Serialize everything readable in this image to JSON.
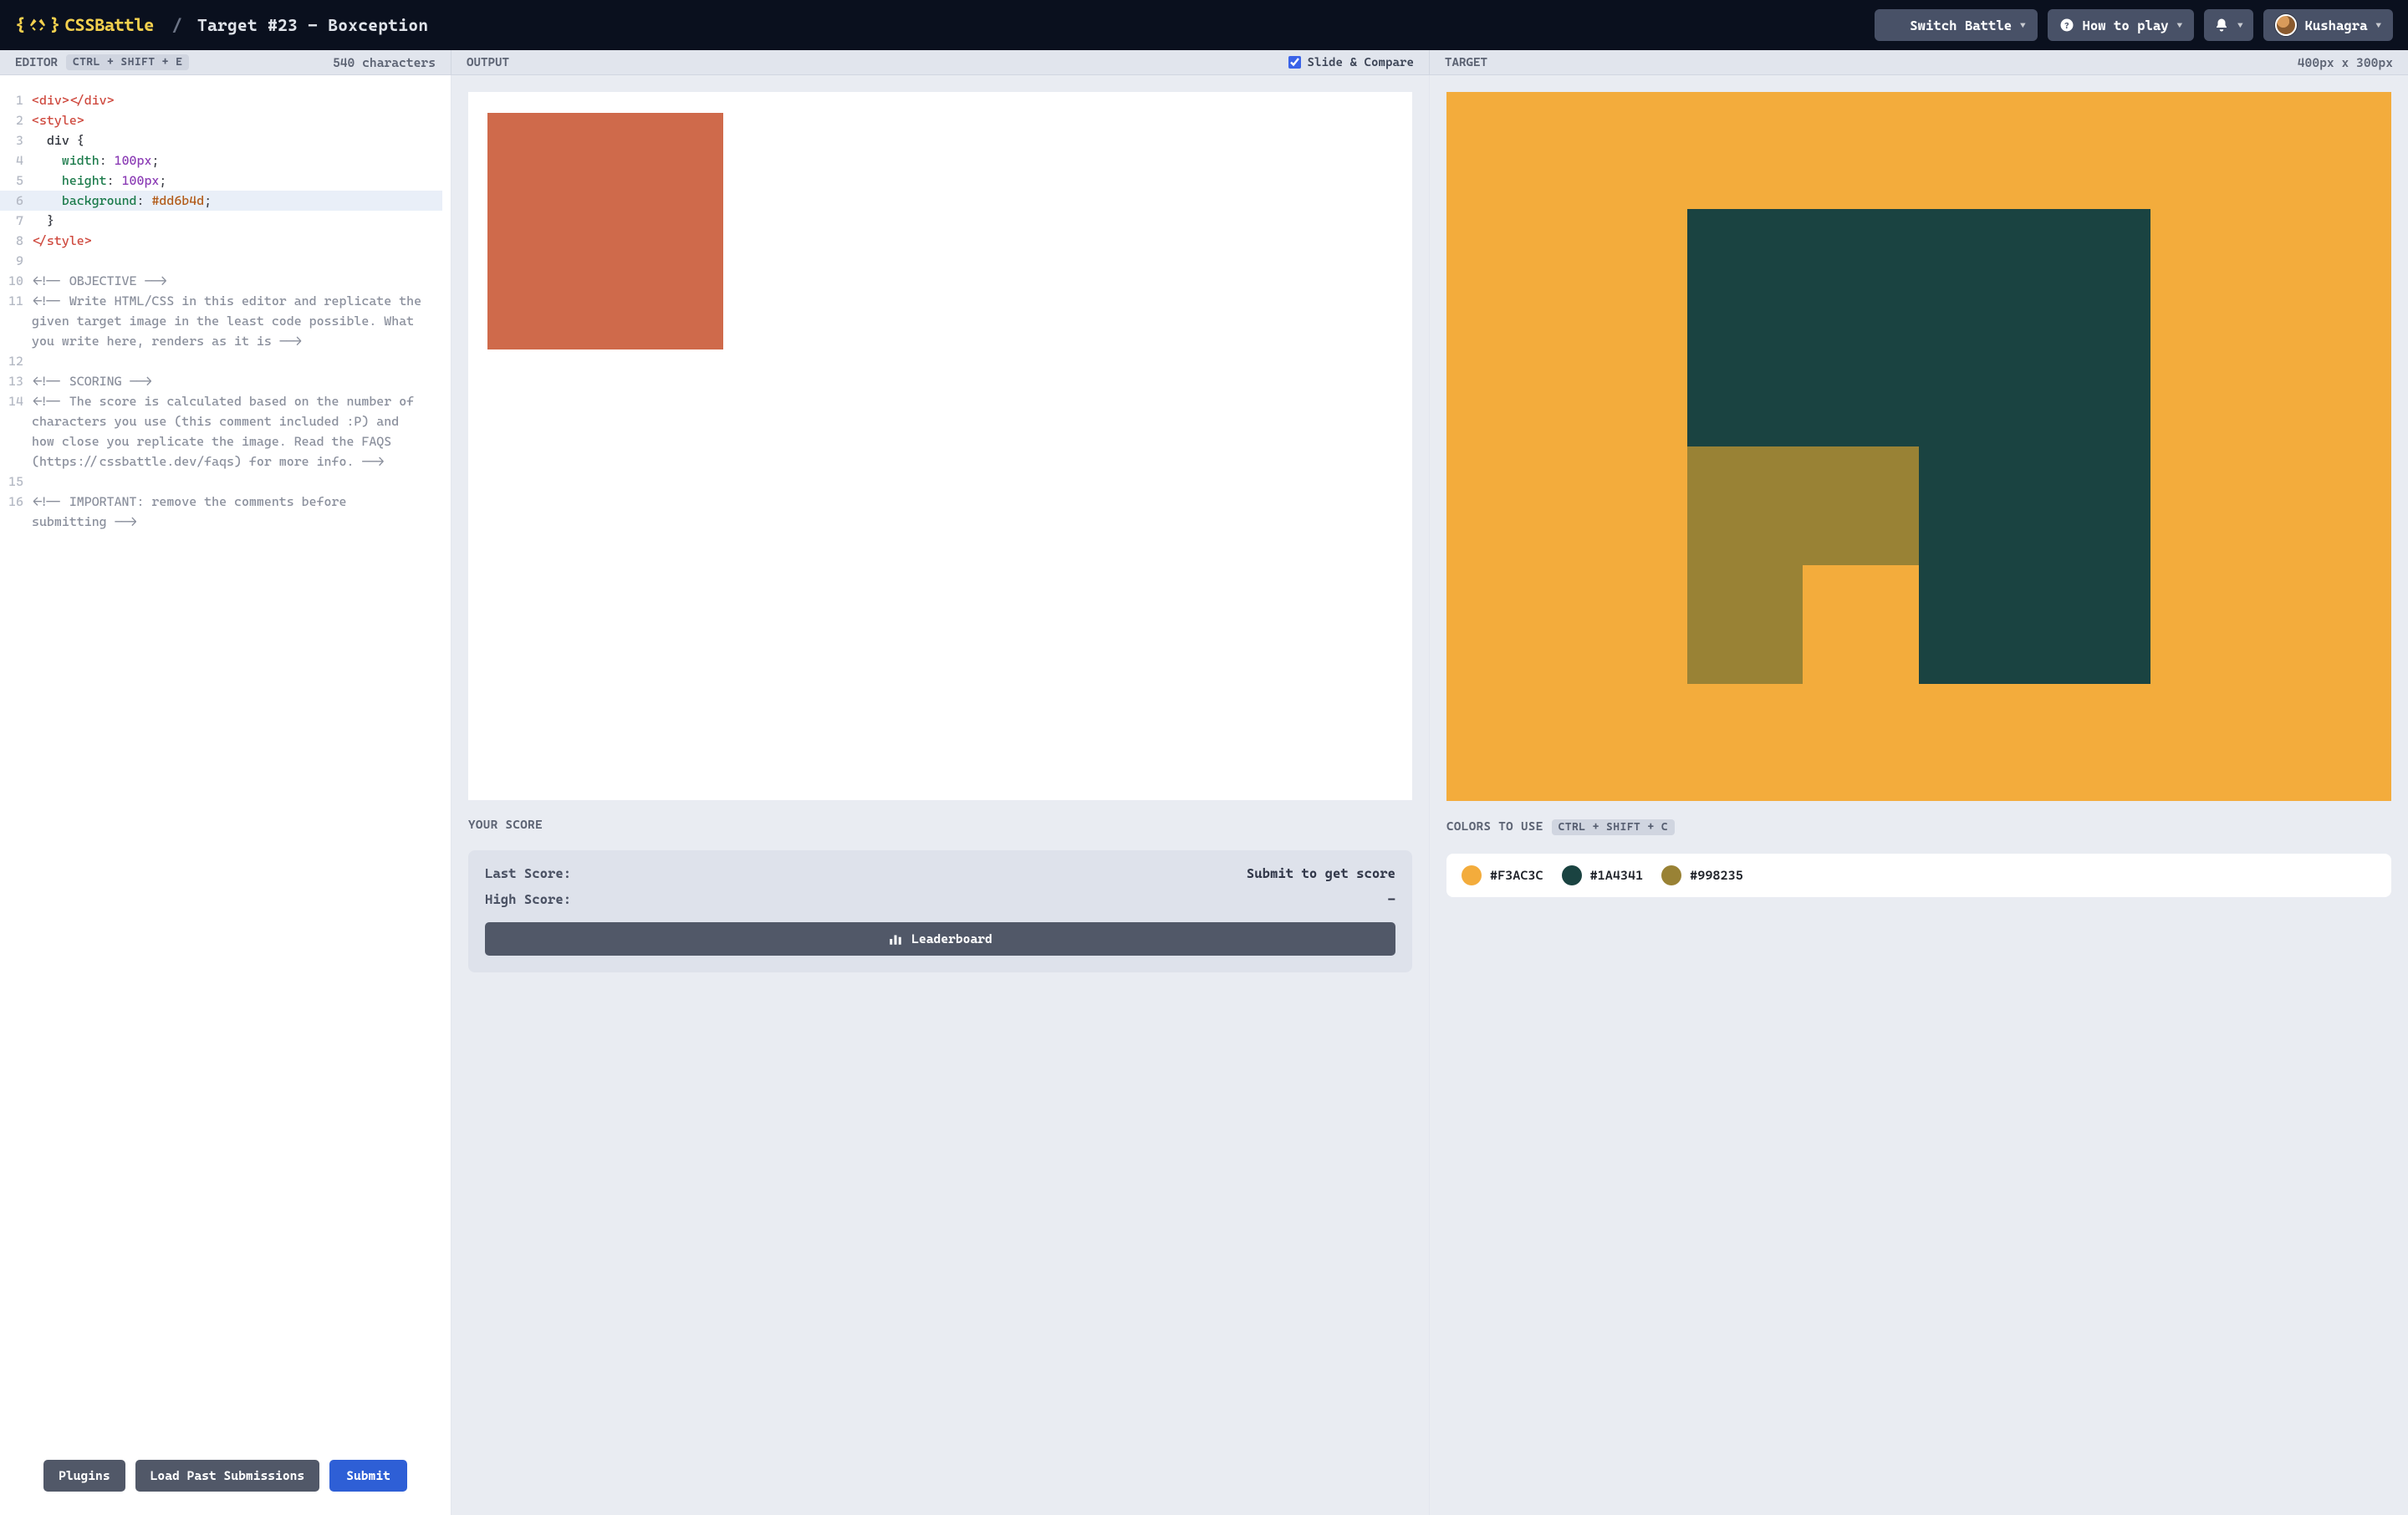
{
  "header": {
    "brand": "CSSBattle",
    "breadcrumb_slash": "/",
    "breadcrumb": "Target #23 - Boxception",
    "switch_battle": "Switch Battle",
    "how_to_play": "How to play",
    "username": "Kushagra"
  },
  "panels": {
    "editor": {
      "title": "EDITOR",
      "shortcut": "CTRL + SHIFT + E",
      "char_count": "540 characters"
    },
    "output": {
      "title": "OUTPUT",
      "slide_compare": "Slide & Compare",
      "slide_compare_checked": true
    },
    "target": {
      "title": "TARGET",
      "dimensions": "400px x 300px"
    }
  },
  "code_lines": [
    {
      "n": 1,
      "parts": [
        {
          "c": "tok-tag",
          "t": "<div></div>"
        }
      ]
    },
    {
      "n": 2,
      "parts": [
        {
          "c": "tok-tag",
          "t": "<style>"
        }
      ]
    },
    {
      "n": 3,
      "parts": [
        {
          "c": "tok-sel",
          "t": "  div "
        },
        {
          "c": "tok-punc",
          "t": "{"
        }
      ]
    },
    {
      "n": 4,
      "parts": [
        {
          "c": "",
          "t": "    "
        },
        {
          "c": "tok-prop",
          "t": "width"
        },
        {
          "c": "tok-punc",
          "t": ": "
        },
        {
          "c": "tok-num",
          "t": "100px"
        },
        {
          "c": "tok-punc",
          "t": ";"
        }
      ]
    },
    {
      "n": 5,
      "parts": [
        {
          "c": "",
          "t": "    "
        },
        {
          "c": "tok-prop",
          "t": "height"
        },
        {
          "c": "tok-punc",
          "t": ": "
        },
        {
          "c": "tok-num",
          "t": "100px"
        },
        {
          "c": "tok-punc",
          "t": ";"
        }
      ]
    },
    {
      "n": 6,
      "hl": true,
      "parts": [
        {
          "c": "",
          "t": "    "
        },
        {
          "c": "tok-prop",
          "t": "background"
        },
        {
          "c": "tok-punc",
          "t": ": "
        },
        {
          "c": "tok-hex",
          "t": "#dd6b4d"
        },
        {
          "c": "tok-punc",
          "t": ";"
        }
      ]
    },
    {
      "n": 7,
      "parts": [
        {
          "c": "tok-punc",
          "t": "  }"
        }
      ]
    },
    {
      "n": 8,
      "parts": [
        {
          "c": "tok-tag",
          "t": "</style>"
        }
      ]
    },
    {
      "n": 9,
      "parts": [
        {
          "c": "",
          "t": ""
        }
      ]
    },
    {
      "n": 10,
      "parts": [
        {
          "c": "",
          "t": "<!-- OBJECTIVE -->"
        }
      ]
    },
    {
      "n": 11,
      "parts": [
        {
          "c": "",
          "t": "<!-- Write HTML/CSS in this editor and replicate the given target image in the least code possible. What you write here, renders as it is -->"
        }
      ]
    },
    {
      "n": 12,
      "parts": [
        {
          "c": "",
          "t": ""
        }
      ]
    },
    {
      "n": 13,
      "parts": [
        {
          "c": "",
          "t": "<!-- SCORING -->"
        }
      ]
    },
    {
      "n": 14,
      "parts": [
        {
          "c": "",
          "t": "<!-- The score is calculated based on the number of characters you use (this comment included :P) and how close you replicate the image. Read the FAQS (https://cssbattle.dev/faqs) for more info. -->"
        }
      ]
    },
    {
      "n": 15,
      "parts": [
        {
          "c": "",
          "t": ""
        }
      ]
    },
    {
      "n": 16,
      "parts": [
        {
          "c": "",
          "t": "<!-- IMPORTANT: remove the comments before submitting -->"
        }
      ]
    }
  ],
  "editor_buttons": {
    "plugins": "Plugins",
    "load_past": "Load Past Submissions",
    "submit": "Submit"
  },
  "score": {
    "title": "YOUR SCORE",
    "last_label": "Last Score:",
    "last_value": "Submit to get score",
    "high_label": "High Score:",
    "high_value": "-",
    "leaderboard": "Leaderboard"
  },
  "colors_section": {
    "title": "COLORS TO USE",
    "shortcut": "CTRL + SHIFT + C",
    "swatches": [
      {
        "hex": "#F3AC3C"
      },
      {
        "hex": "#1A4341"
      },
      {
        "hex": "#998235"
      }
    ]
  }
}
